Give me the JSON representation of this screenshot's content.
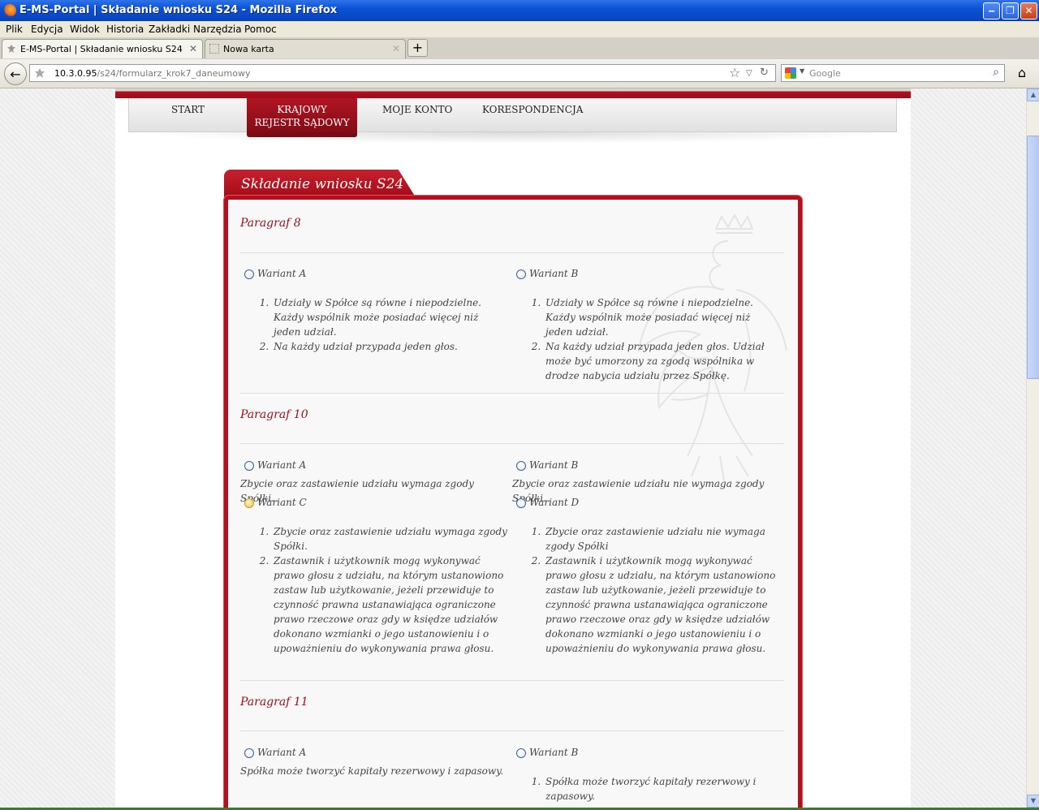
{
  "window": {
    "title": "E-MS-Portal | Składanie wniosku S24 - Mozilla Firefox",
    "minimize": "‒",
    "maximize": "❐",
    "close": "✕"
  },
  "menu": [
    "Plik",
    "Edycja",
    "Widok",
    "Historia",
    "Zakładki",
    "Narzędzia",
    "Pomoc"
  ],
  "tabs": [
    {
      "label": "E-MS-Portal | Składanie wniosku S24",
      "close": "✕"
    },
    {
      "label": "Nowa karta",
      "close": "✕"
    }
  ],
  "new_tab": "+",
  "navbar": {
    "back": "←",
    "url_host": "10.3.0.95",
    "url_path": "/s24/formularz_krok7_daneumowy",
    "search_placeholder": "Google",
    "star": "☆",
    "dropdown": "▽",
    "reload": "↻",
    "search_go": "⌕",
    "home": "⌂"
  },
  "site_nav": {
    "start": "START",
    "krs_line1": "KRAJOWY",
    "krs_line2": "REJESTR SĄDOWY",
    "account": "MOJE KONTO",
    "corr": "KORESPONDENCJA"
  },
  "form": {
    "title": "Składanie wniosku S24",
    "p8": {
      "title": "Paragraf 8",
      "a_label": "Wariant A",
      "a_items": [
        "Udziały w Spółce są równe i niepodzielne. Każdy wspólnik może posiadać więcej niż jeden udział.",
        "Na każdy udział przypada jeden głos."
      ],
      "b_label": "Wariant B",
      "b_items": [
        "Udziały w Spółce są równe i niepodzielne. Każdy wspólnik może posiadać więcej niż jeden udział.",
        "Na każdy udział przypada jeden głos. Udział może być umorzony za zgodą wspólnika w drodze nabycia udziału przez Spółkę."
      ]
    },
    "p10": {
      "title": "Paragraf 10",
      "a_label": "Wariant A",
      "a_text": "Zbycie oraz zastawienie udziału wymaga zgody Spółki.",
      "b_label": "Wariant B",
      "b_text": "Zbycie oraz zastawienie udziału nie wymaga zgody Spółki.",
      "c_label": "Wariant C",
      "c_items": [
        "Zbycie oraz zastawienie udziału wymaga zgody Spółki.",
        "Zastawnik i użytkownik mogą wykonywać prawo głosu z udziału, na którym ustanowiono zastaw lub użytkowanie, jeżeli przewiduje to czynność prawna ustanawiająca ograniczone prawo rzeczowe oraz gdy w księdze udziałów dokonano wzmianki o jego ustanowieniu i o upoważnieniu do wykonywania prawa głosu."
      ],
      "d_label": "Wariant D",
      "d_items": [
        "Zbycie oraz zastawienie udziału nie wymaga zgody Spółki",
        "Zastawnik i użytkownik mogą wykonywać prawo głosu z udziału, na którym ustanowiono zastaw lub użytkowanie, jeżeli przewiduje to czynność prawna ustanawiająca ograniczone prawo rzeczowe oraz gdy w księdze udziałów dokonano wzmianki o jego ustanowieniu i o upoważnieniu do wykonywania prawa głosu."
      ]
    },
    "p11": {
      "title": "Paragraf 11",
      "a_label": "Wariant A",
      "a_text": "Spółka może tworzyć kapitały rezerwowy i zapasowy.",
      "b_label": "Wariant B",
      "b_items": [
        "Spółka może tworzyć kapitały rezerwowy i zapasowy."
      ]
    }
  }
}
